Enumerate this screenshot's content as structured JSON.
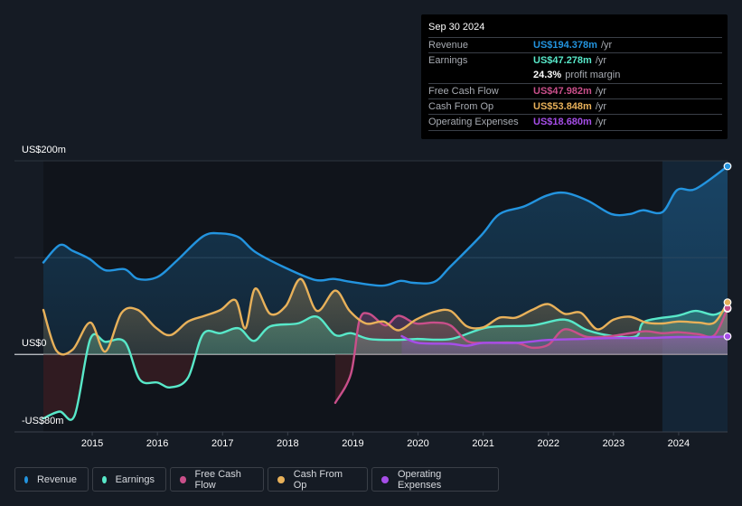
{
  "tooltip": {
    "date": "Sep 30 2024",
    "rows": [
      {
        "label": "Revenue",
        "value": "US$194.378m",
        "unit": "/yr",
        "color": "#2394df"
      },
      {
        "label": "Earnings",
        "value": "US$47.278m",
        "unit": "/yr",
        "color": "#58e8c9"
      },
      {
        "label": "",
        "margin_value": "24.3%",
        "margin_text": "profit margin"
      },
      {
        "label": "Free Cash Flow",
        "value": "US$47.982m",
        "unit": "/yr",
        "color": "#c94f8a"
      },
      {
        "label": "Cash From Op",
        "value": "US$53.848m",
        "unit": "/yr",
        "color": "#e8b15a"
      },
      {
        "label": "Operating Expenses",
        "value": "US$18.680m",
        "unit": "/yr",
        "color": "#a64ee8"
      }
    ]
  },
  "legend": [
    {
      "label": "Revenue",
      "color": "#2394df"
    },
    {
      "label": "Earnings",
      "color": "#58e8c9"
    },
    {
      "label": "Free Cash Flow",
      "color": "#c94f8a"
    },
    {
      "label": "Cash From Op",
      "color": "#e8b15a"
    },
    {
      "label": "Operating Expenses",
      "color": "#a64ee8"
    }
  ],
  "chart_data": {
    "type": "area",
    "title": "",
    "xlabel": "",
    "ylabel": "",
    "ylim": [
      -80,
      200
    ],
    "xlim": [
      2014.25,
      2024.75
    ],
    "y_tick_labels": [
      {
        "value": 200,
        "label": "US$200m"
      },
      {
        "value": 0,
        "label": "US$0"
      },
      {
        "value": -80,
        "label": "-US$80m"
      }
    ],
    "gridlines": [
      200,
      100,
      0
    ],
    "x_tick_labels": [
      "2015",
      "2016",
      "2017",
      "2018",
      "2019",
      "2020",
      "2021",
      "2022",
      "2023",
      "2024"
    ],
    "x_ticks": [
      2015,
      2016,
      2017,
      2018,
      2019,
      2020,
      2021,
      2022,
      2023,
      2024
    ],
    "highlight_from": 2023.75,
    "series": [
      {
        "name": "Revenue",
        "color": "#2394df",
        "x": [
          2014.25,
          2014.5,
          2014.7,
          2014.95,
          2015.2,
          2015.5,
          2015.7,
          2016.0,
          2016.3,
          2016.7,
          2016.97,
          2017.25,
          2017.5,
          2017.95,
          2018.42,
          2018.7,
          2018.97,
          2019.45,
          2019.73,
          2019.93,
          2020.25,
          2020.5,
          2020.97,
          2021.25,
          2021.63,
          2021.97,
          2022.25,
          2022.6,
          2022.97,
          2023.25,
          2023.45,
          2023.75,
          2023.98,
          2024.26,
          2024.75
        ],
        "values": [
          95,
          113,
          107,
          99,
          87,
          88,
          78,
          80,
          97,
          122,
          125,
          121,
          106,
          90,
          77,
          78,
          75,
          71,
          76,
          74,
          75,
          91,
          123,
          145,
          153,
          164,
          167,
          159,
          145,
          145,
          149,
          147,
          170,
          171,
          194.378
        ]
      },
      {
        "name": "Earnings",
        "color": "#58e8c9",
        "x": [
          2014.25,
          2014.5,
          2014.73,
          2014.97,
          2015.2,
          2015.5,
          2015.73,
          2016.0,
          2016.2,
          2016.47,
          2016.7,
          2016.97,
          2017.25,
          2017.48,
          2017.73,
          2018.15,
          2018.45,
          2018.73,
          2018.97,
          2019.25,
          2019.67,
          2019.97,
          2020.5,
          2021.07,
          2021.75,
          2022.25,
          2022.6,
          2023.0,
          2023.35,
          2023.48,
          2023.98,
          2024.26,
          2024.54,
          2024.75
        ],
        "values": [
          -66,
          -59,
          -63,
          16,
          13,
          13,
          -26,
          -29,
          -34,
          -24,
          21,
          22,
          27,
          14,
          29,
          32,
          39,
          20,
          22,
          16,
          15,
          16,
          16,
          28,
          30,
          36,
          25,
          19,
          19,
          34,
          40,
          45,
          41,
          47.278
        ]
      },
      {
        "name": "Free Cash Flow",
        "color": "#c94f8a",
        "x": [
          2018.73,
          2018.97,
          2019.1,
          2019.25,
          2019.5,
          2019.7,
          2019.97,
          2020.25,
          2020.5,
          2020.75,
          2021.0,
          2021.5,
          2021.75,
          2022.0,
          2022.25,
          2022.6,
          2022.97,
          2023.25,
          2023.5,
          2023.75,
          2024.0,
          2024.3,
          2024.55,
          2024.75
        ],
        "values": [
          -50,
          -20,
          35,
          42,
          30,
          40,
          32,
          33,
          30,
          14,
          12,
          12,
          7,
          10,
          26,
          18,
          19,
          22,
          24,
          22,
          23,
          21,
          20,
          47.982
        ]
      },
      {
        "name": "Cash From Op",
        "color": "#e8b15a",
        "x": [
          2014.25,
          2014.45,
          2014.7,
          2014.97,
          2015.2,
          2015.45,
          2015.7,
          2015.97,
          2016.2,
          2016.47,
          2016.73,
          2016.97,
          2017.2,
          2017.35,
          2017.5,
          2017.73,
          2017.97,
          2018.2,
          2018.45,
          2018.73,
          2018.95,
          2019.2,
          2019.47,
          2019.7,
          2019.97,
          2020.25,
          2020.5,
          2020.75,
          2021.0,
          2021.25,
          2021.5,
          2021.75,
          2022.0,
          2022.25,
          2022.5,
          2022.75,
          2023.0,
          2023.25,
          2023.5,
          2023.75,
          2024.0,
          2024.3,
          2024.55,
          2024.75
        ],
        "values": [
          46,
          4,
          5,
          33,
          3,
          43,
          46,
          28,
          20,
          34,
          40,
          46,
          56,
          27,
          68,
          42,
          50,
          78,
          45,
          66,
          45,
          32,
          34,
          25,
          36,
          44,
          45,
          29,
          28,
          38,
          38,
          46,
          52,
          42,
          43,
          26,
          36,
          39,
          33,
          32,
          34,
          33,
          33,
          53.848
        ]
      },
      {
        "name": "Operating Expenses",
        "color": "#a64ee8",
        "x": [
          2019.75,
          2020.0,
          2020.5,
          2020.75,
          2021.0,
          2021.5,
          2022.0,
          2022.5,
          2023.0,
          2023.5,
          2023.98,
          2024.5,
          2024.75
        ],
        "values": [
          19,
          12,
          11,
          9,
          12,
          12,
          15,
          16,
          17,
          17,
          18,
          18,
          18.68
        ]
      }
    ]
  }
}
